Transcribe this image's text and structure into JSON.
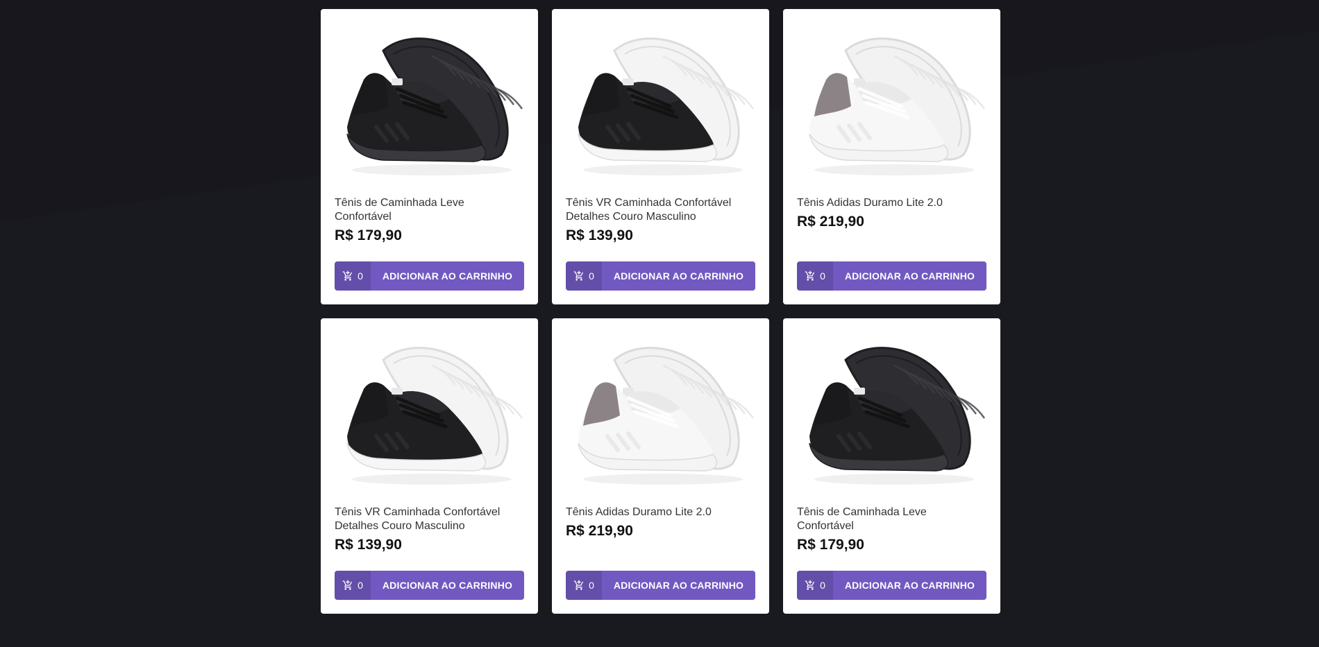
{
  "theme": {
    "background": "#191920",
    "background_light": "#25252c",
    "accent": "#7159c1",
    "card": "#ffffff"
  },
  "products": [
    {
      "title": "Tênis de Caminhada Leve Confortável",
      "price": "R$ 179,90",
      "cart_count": "0",
      "button_label": "ADICIONAR AO CARRINHO",
      "image_icon": "black-sneaker-image",
      "variant": "black"
    },
    {
      "title": "Tênis VR Caminhada Confortável Detalhes Couro Masculino",
      "price": "R$ 139,90",
      "cart_count": "0",
      "button_label": "ADICIONAR AO CARRINHO",
      "image_icon": "black-white-sneaker-image",
      "variant": "blackwhite"
    },
    {
      "title": "Tênis Adidas Duramo Lite 2.0",
      "price": "R$ 219,90",
      "cart_count": "0",
      "button_label": "ADICIONAR AO CARRINHO",
      "image_icon": "white-gray-sneaker-image",
      "variant": "whitegray"
    },
    {
      "title": "Tênis VR Caminhada Confortável Detalhes Couro Masculino",
      "price": "R$ 139,90",
      "cart_count": "0",
      "button_label": "ADICIONAR AO CARRINHO",
      "image_icon": "black-white-sneaker-image",
      "variant": "blackwhite"
    },
    {
      "title": "Tênis Adidas Duramo Lite 2.0",
      "price": "R$ 219,90",
      "cart_count": "0",
      "button_label": "ADICIONAR AO CARRINHO",
      "image_icon": "white-gray-sneaker-image",
      "variant": "whitegray"
    },
    {
      "title": "Tênis de Caminhada Leve Confortável",
      "price": "R$ 179,90",
      "cart_count": "0",
      "button_label": "ADICIONAR AO CARRINHO",
      "image_icon": "black-sneaker-image",
      "variant": "black"
    }
  ]
}
